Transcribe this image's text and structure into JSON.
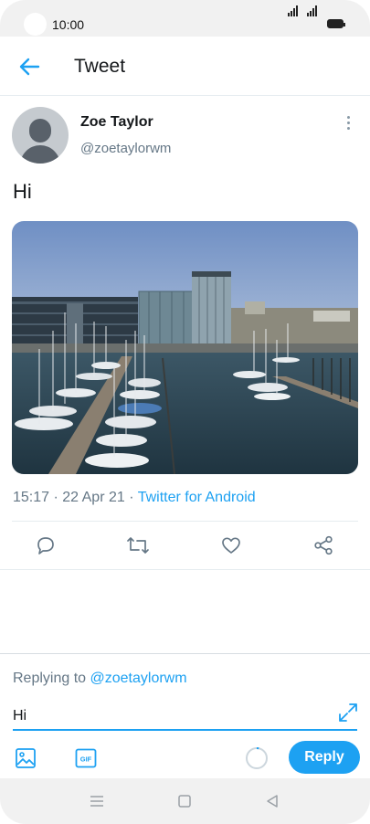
{
  "status_bar": {
    "time": "10:00"
  },
  "header": {
    "title": "Tweet",
    "back_icon": "arrow-left-icon"
  },
  "tweet": {
    "author_name": "Zoe Taylor",
    "author_handle": "@zoetaylorwm",
    "text": "Hi",
    "time": "15:17",
    "date": "22 Apr 21",
    "source": "Twitter for Android",
    "separator": " · "
  },
  "actions": [
    {
      "name": "reply",
      "icon": "comment-icon"
    },
    {
      "name": "retweet",
      "icon": "retweet-icon"
    },
    {
      "name": "like",
      "icon": "heart-icon"
    },
    {
      "name": "share",
      "icon": "share-icon"
    }
  ],
  "reply": {
    "replying_prefix": "Replying to ",
    "replying_handle": "@zoetaylorwm",
    "value": "Hi",
    "button_label": "Reply"
  },
  "colors": {
    "accent": "#1da1f2",
    "muted": "#657786",
    "text": "#14171a"
  }
}
